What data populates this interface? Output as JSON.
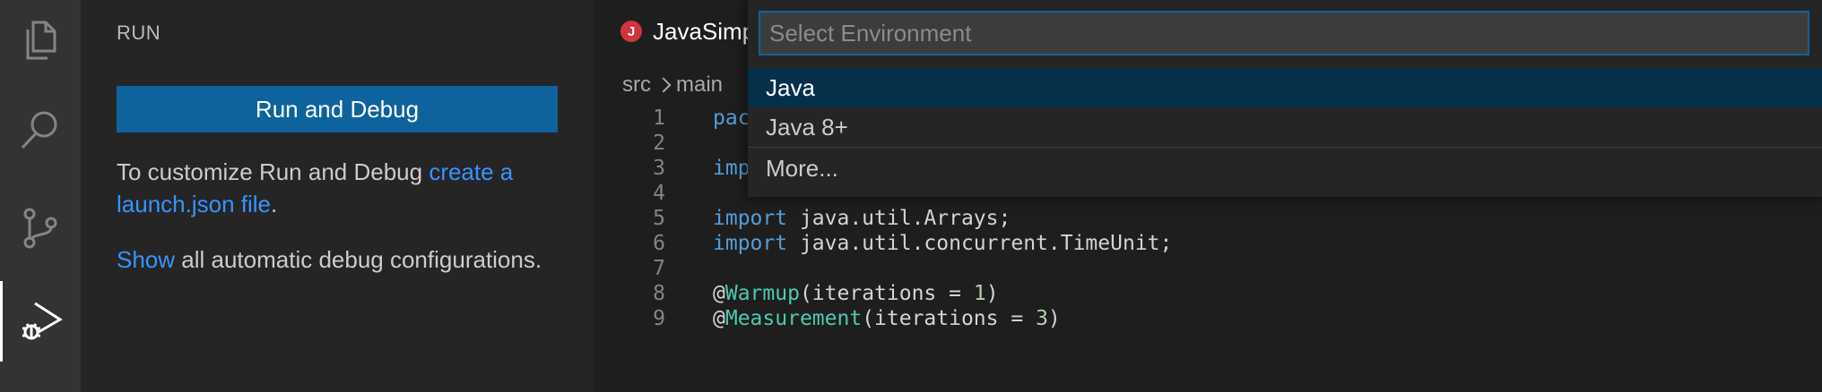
{
  "activity_bar": {
    "items": [
      {
        "icon": "files-icon"
      },
      {
        "icon": "search-icon"
      },
      {
        "icon": "source-control-icon"
      },
      {
        "icon": "run-debug-icon",
        "active": true
      }
    ]
  },
  "sidebar": {
    "title": "RUN",
    "run_button_label": "Run and Debug",
    "customize": {
      "prefix": "To customize Run and Debug ",
      "link": "create a launch.json file",
      "suffix": "."
    },
    "show": {
      "link": "Show",
      "suffix": " all automatic debug configurations."
    }
  },
  "editor": {
    "tab": {
      "badge": "J",
      "label": "JavaSimpleBenchmark.java"
    },
    "breadcrumb": [
      "src",
      "main"
    ],
    "lines": [
      {
        "num": "1",
        "text": "package"
      },
      {
        "num": "2",
        "text": ""
      },
      {
        "num": "3",
        "text": "import"
      },
      {
        "num": "4",
        "text": ""
      },
      {
        "num": "5",
        "kw": "import",
        "rest": " java.util.Arrays;"
      },
      {
        "num": "6",
        "kw": "import",
        "rest": " java.util.concurrent.TimeUnit;"
      },
      {
        "num": "7",
        "text": ""
      },
      {
        "num": "8",
        "at": "@",
        "ann": "Warmup",
        "args_pre": "(iterations = ",
        "value": "1",
        "args_post": ")"
      },
      {
        "num": "9",
        "at": "@",
        "ann": "Measurement",
        "args_pre": "(iterations = ",
        "value": "3",
        "args_post": ")"
      }
    ]
  },
  "quick_pick": {
    "placeholder": "Select Environment",
    "items": [
      {
        "label": "Java",
        "selected": true
      },
      {
        "label": "Java 8+"
      },
      {
        "label": "More..."
      }
    ]
  },
  "colors": {
    "accent": "#0e639c",
    "link": "#3794ff",
    "keyword": "#569cd6",
    "annotation": "#4ec9b0",
    "number": "#b5cea8"
  }
}
